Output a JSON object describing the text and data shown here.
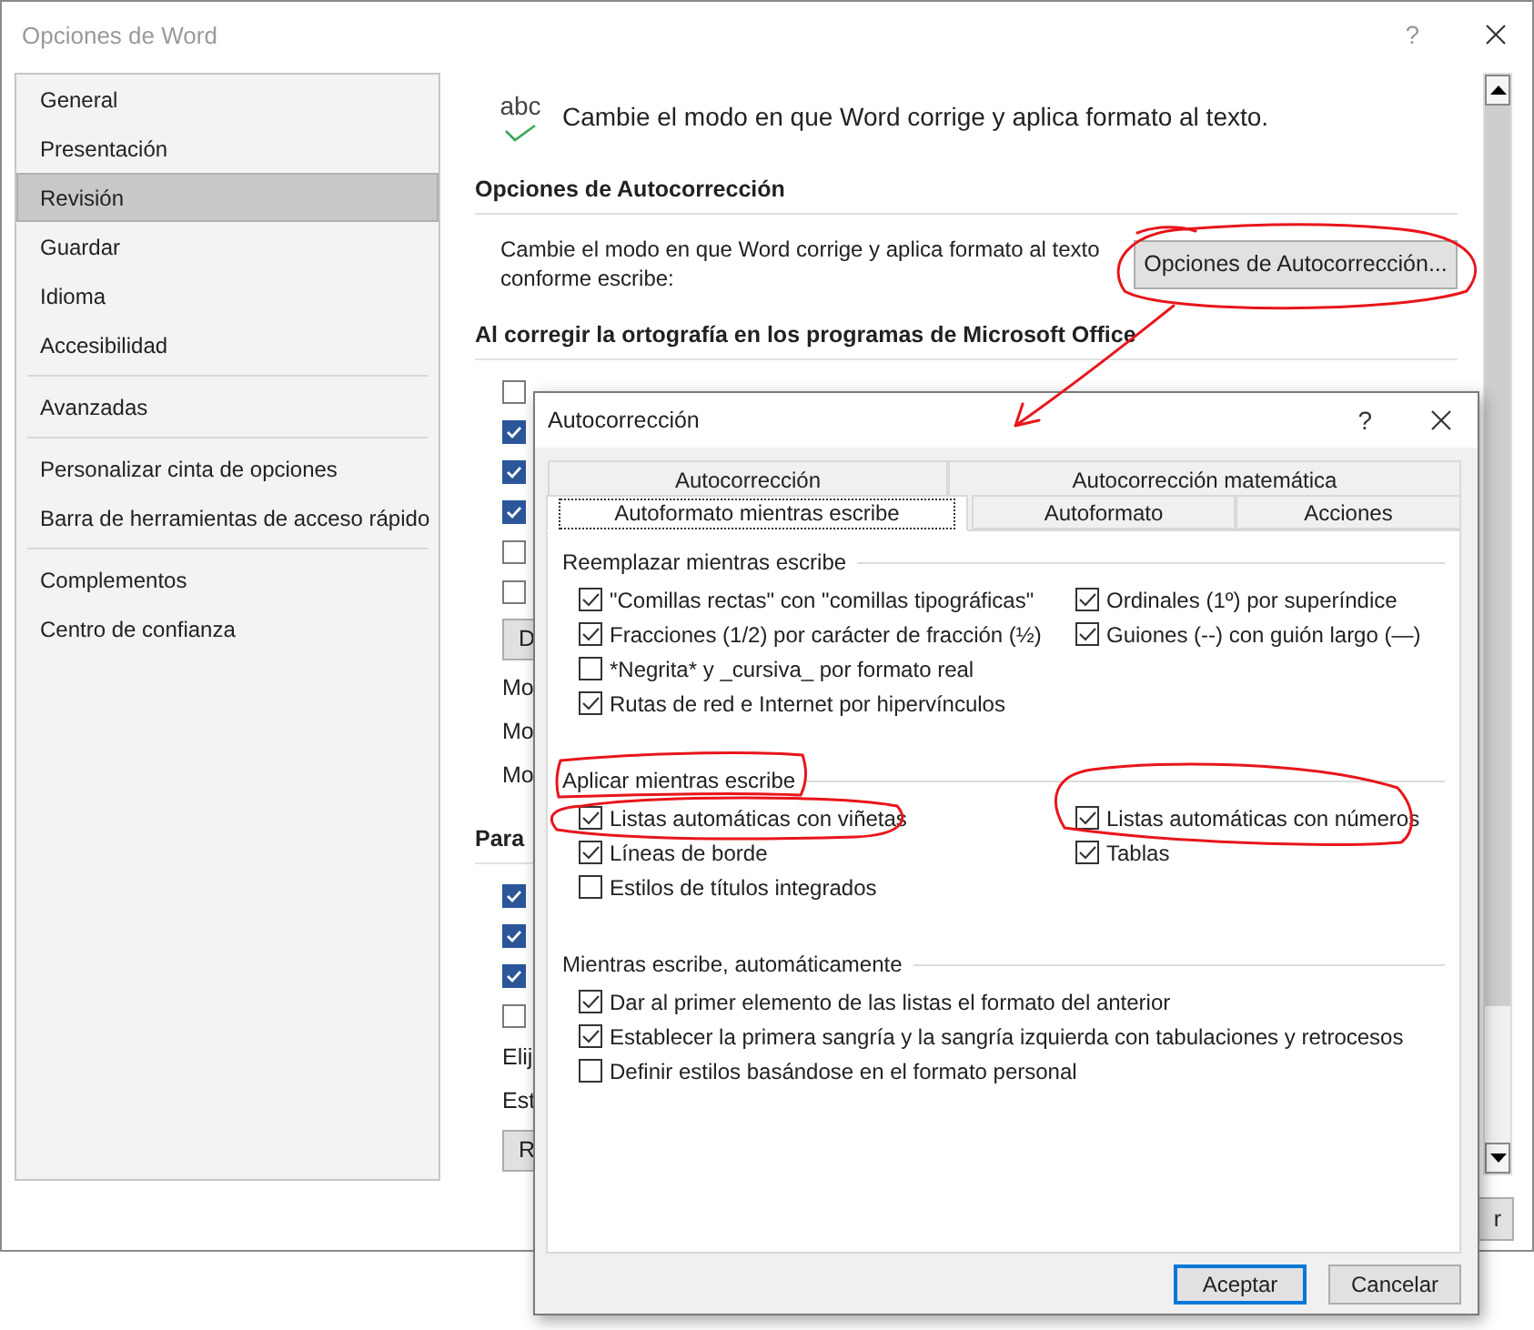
{
  "options_window": {
    "title": "Opciones de Word",
    "help_label": "?",
    "nav_groups": [
      {
        "items": [
          {
            "label": "General",
            "selected": false
          },
          {
            "label": "Presentación",
            "selected": false
          },
          {
            "label": "Revisión",
            "selected": true
          },
          {
            "label": "Guardar",
            "selected": false
          },
          {
            "label": "Idioma",
            "selected": false
          },
          {
            "label": "Accesibilidad",
            "selected": false
          }
        ]
      },
      {
        "items": [
          {
            "label": "Avanzadas",
            "selected": false
          }
        ]
      },
      {
        "items": [
          {
            "label": "Personalizar cinta de opciones",
            "selected": false
          },
          {
            "label": "Barra de herramientas de acceso rápido",
            "selected": false
          }
        ]
      },
      {
        "items": [
          {
            "label": "Complementos",
            "selected": false
          },
          {
            "label": "Centro de confianza",
            "selected": false
          }
        ]
      }
    ],
    "icon_text": "abc",
    "header_text": "Cambie el modo en que Word corrige y aplica formato al texto.",
    "autocorrect_section": {
      "heading": "Opciones de Autocorrección",
      "description": "Cambie el modo en que Word corrige y aplica formato al texto conforme escribe:",
      "button": "Opciones de Autocorrección..."
    },
    "sections": [
      {
        "heading": "Al corregir la ortografía en los programas de Microsoft Office",
        "rows": [
          {
            "kind": "checkbox",
            "checked": false
          },
          {
            "kind": "checkbox",
            "checked": true
          },
          {
            "kind": "checkbox",
            "checked": true
          },
          {
            "kind": "checkbox",
            "checked": true
          },
          {
            "kind": "checkbox",
            "checked": false
          },
          {
            "kind": "checkbox",
            "checked": false
          },
          {
            "kind": "button",
            "label": "D"
          },
          {
            "kind": "text",
            "label": "Mo"
          },
          {
            "kind": "text",
            "label": "Mo"
          },
          {
            "kind": "text",
            "label": "Mo"
          }
        ]
      },
      {
        "heading": "Para",
        "rows": [
          {
            "kind": "checkbox",
            "checked": true
          },
          {
            "kind": "checkbox",
            "checked": true
          },
          {
            "kind": "checkbox",
            "checked": true
          },
          {
            "kind": "checkbox",
            "checked": false
          },
          {
            "kind": "text",
            "label": "Elij"
          },
          {
            "kind": "text",
            "label": "Est"
          },
          {
            "kind": "button",
            "label": "R"
          }
        ]
      }
    ],
    "footer_button": "r"
  },
  "autocorrect_dialog": {
    "title": "Autocorrección",
    "help_label": "?",
    "tab_rows": [
      {
        "tabs": [
          {
            "label": "Autocorrección",
            "selected": false
          },
          {
            "label": "Autocorrección matemática",
            "selected": false
          }
        ]
      },
      {
        "tabs": [
          {
            "label": "Autoformato mientras escribe",
            "selected": true
          },
          {
            "label": "Autoformato",
            "selected": false
          },
          {
            "label": "Acciones",
            "selected": false
          }
        ]
      }
    ],
    "groups": [
      {
        "title": "Reemplazar mientras escribe",
        "columns": [
          {
            "items": [
              {
                "label": "\"Comillas rectas\" con \"comillas tipográficas\"",
                "checked": true
              },
              {
                "label": "Fracciones (1/2) por carácter de fracción (½)",
                "checked": true
              },
              {
                "label": "*Negrita* y _cursiva_ por formato real",
                "checked": false
              },
              {
                "label": "Rutas de red e Internet por hipervínculos",
                "checked": true
              }
            ]
          },
          {
            "items": [
              {
                "label": "Ordinales (1º) por superíndice",
                "checked": true
              },
              {
                "label": "Guiones (--) con guión largo (—)",
                "checked": true
              }
            ]
          }
        ]
      },
      {
        "title": "Aplicar mientras escribe",
        "columns": [
          {
            "items": [
              {
                "label": "Listas automáticas con viñetas",
                "checked": true
              },
              {
                "label": "Líneas de borde",
                "checked": true
              },
              {
                "label": "Estilos de títulos integrados",
                "checked": false
              }
            ]
          },
          {
            "items": [
              {
                "label": "Listas automáticas con números",
                "checked": true
              },
              {
                "label": "Tablas",
                "checked": true
              }
            ]
          }
        ]
      },
      {
        "title": "Mientras escribe, automáticamente",
        "columns": [
          {
            "items": [
              {
                "label": "Dar al primer elemento de las listas el formato del anterior",
                "checked": true
              },
              {
                "label": "Establecer la primera sangría y la sangría izquierda con tabulaciones y retrocesos",
                "checked": true
              },
              {
                "label": "Definir estilos basándose en el formato personal",
                "checked": false
              }
            ]
          }
        ]
      }
    ],
    "buttons": [
      {
        "label": "Aceptar",
        "default": true
      },
      {
        "label": "Cancelar",
        "default": false
      }
    ]
  }
}
